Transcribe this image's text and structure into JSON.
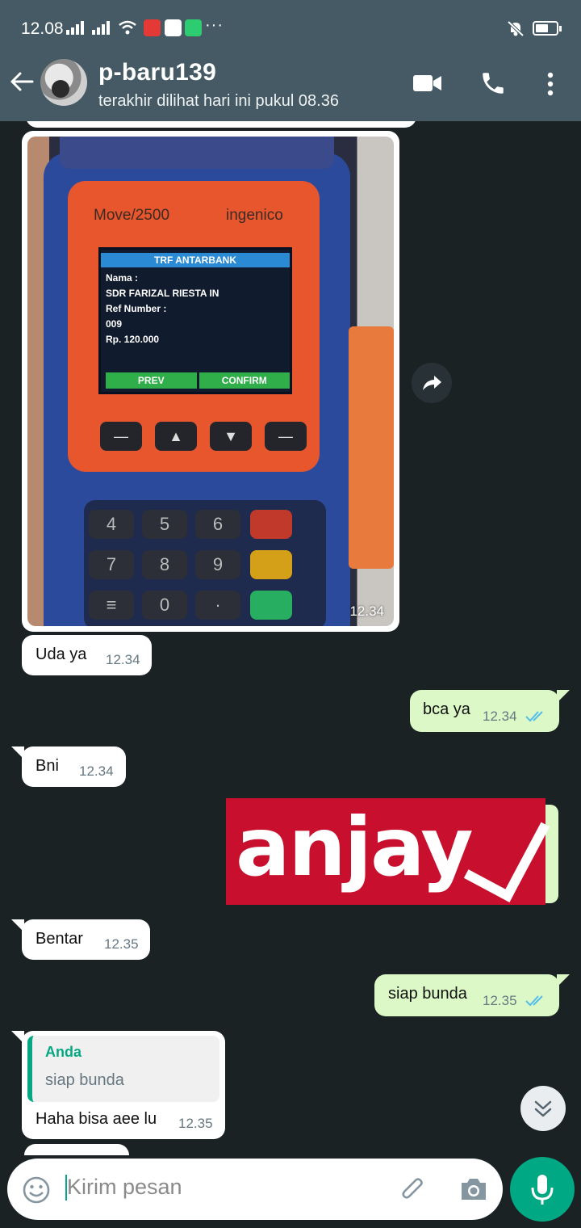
{
  "status_bar": {
    "time": "12.08",
    "dots": "···"
  },
  "header": {
    "contact_name": "p-baru139",
    "last_seen": "terakhir dilihat hari ini pukul 08.36",
    "icons": [
      "back-arrow-icon",
      "video-call-icon",
      "phone-icon",
      "more-vert-icon"
    ]
  },
  "messages": [
    {
      "type": "image",
      "direction": "in",
      "time": "12.34",
      "photo": {
        "brand_left": "Move/2500",
        "brand_right": "ingenico",
        "screen_title": "TRF ANTARBANK",
        "screen_lines": [
          "Nama :",
          "SDR FARIZAL RIESTA IN",
          "Ref Number :",
          "009",
          "Rp. 120.000"
        ],
        "btn_prev": "PREV",
        "btn_confirm": "CONFIRM",
        "keys": [
          "4",
          "5",
          "6",
          "7",
          "8",
          "9",
          "0"
        ]
      }
    },
    {
      "type": "text",
      "direction": "in",
      "text": "Uda ya",
      "time": "12.34"
    },
    {
      "type": "text",
      "direction": "out",
      "text": "bca ya",
      "time": "12.34",
      "status": "read"
    },
    {
      "type": "text",
      "direction": "in",
      "text": "Bni",
      "time": "12.34"
    },
    {
      "type": "sticker",
      "direction": "out",
      "text": "anjay"
    },
    {
      "type": "text",
      "direction": "in",
      "text": "Bentar",
      "time": "12.35"
    },
    {
      "type": "text",
      "direction": "out",
      "text": "siap bunda",
      "time": "12.35",
      "status": "read"
    },
    {
      "type": "reply",
      "direction": "in",
      "quoted_author": "Anda",
      "quoted_text": "siap bunda",
      "text": "Haha bisa aee lu",
      "time": "12.35"
    }
  ],
  "composer": {
    "placeholder": "Kirim pesan"
  },
  "colors": {
    "header": "#455a64",
    "chat_bg": "#1b2224",
    "incoming": "#ffffff",
    "outgoing": "#dcf8c6",
    "accent": "#00a884",
    "read_tick": "#53bdeb"
  }
}
